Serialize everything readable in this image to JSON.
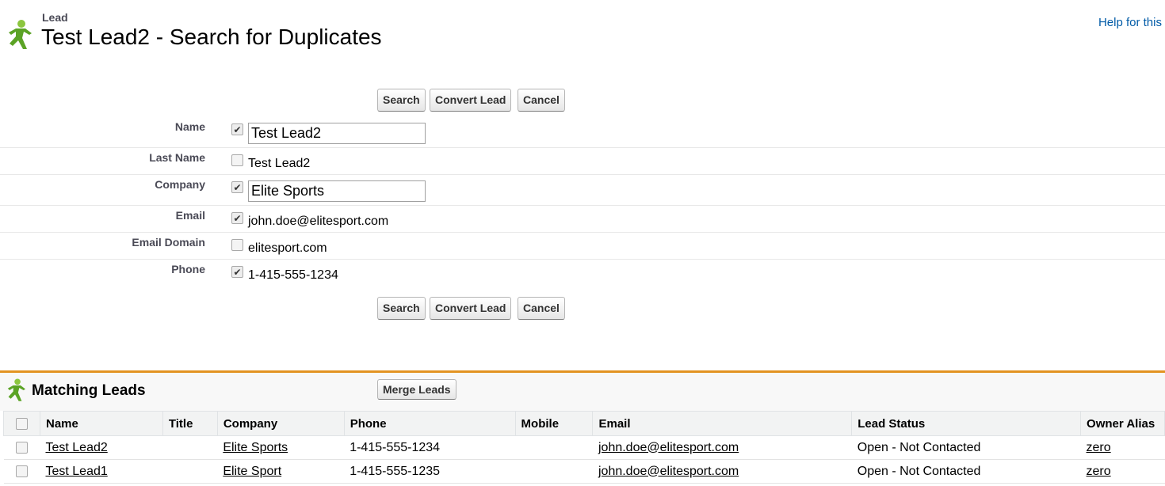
{
  "header": {
    "object_type": "Lead",
    "title": "Test Lead2 - Search for Duplicates",
    "help_link": "Help for this"
  },
  "buttons": {
    "search": "Search",
    "convert_lead": "Convert Lead",
    "cancel": "Cancel"
  },
  "fields": [
    {
      "label": "Name",
      "checked": true,
      "type": "input",
      "value": "Test Lead2"
    },
    {
      "label": "Last Name",
      "checked": false,
      "type": "text",
      "value": "Test Lead2"
    },
    {
      "label": "Company",
      "checked": true,
      "type": "input",
      "value": "Elite Sports"
    },
    {
      "label": "Email",
      "checked": true,
      "type": "text",
      "value": "john.doe@elitesport.com"
    },
    {
      "label": "Email Domain",
      "checked": false,
      "type": "text",
      "value": "elitesport.com"
    },
    {
      "label": "Phone",
      "checked": true,
      "type": "text",
      "value": "1-415-555-1234"
    }
  ],
  "matching": {
    "title": "Matching Leads",
    "merge_button": "Merge Leads",
    "columns": [
      "Name",
      "Title",
      "Company",
      "Phone",
      "Mobile",
      "Email",
      "Lead Status",
      "Owner Alias"
    ],
    "rows": [
      {
        "name": "Test Lead2",
        "title": "",
        "company": "Elite Sports",
        "phone": "1-415-555-1234",
        "mobile": "",
        "email": "john.doe@elitesport.com",
        "status": "Open - Not Contacted",
        "owner": "zero"
      },
      {
        "name": "Test Lead1",
        "title": "",
        "company": "Elite Sport",
        "phone": "1-415-555-1235",
        "mobile": "",
        "email": "john.doe@elitesport.com",
        "status": "Open - Not Contacted",
        "owner": "zero"
      }
    ]
  },
  "colors": {
    "accent": "#e39321",
    "link": "#015ba7",
    "lead_icon": "#5ba325"
  },
  "icons": {
    "lead": "lead-person-icon",
    "check": "checkmark-icon"
  }
}
